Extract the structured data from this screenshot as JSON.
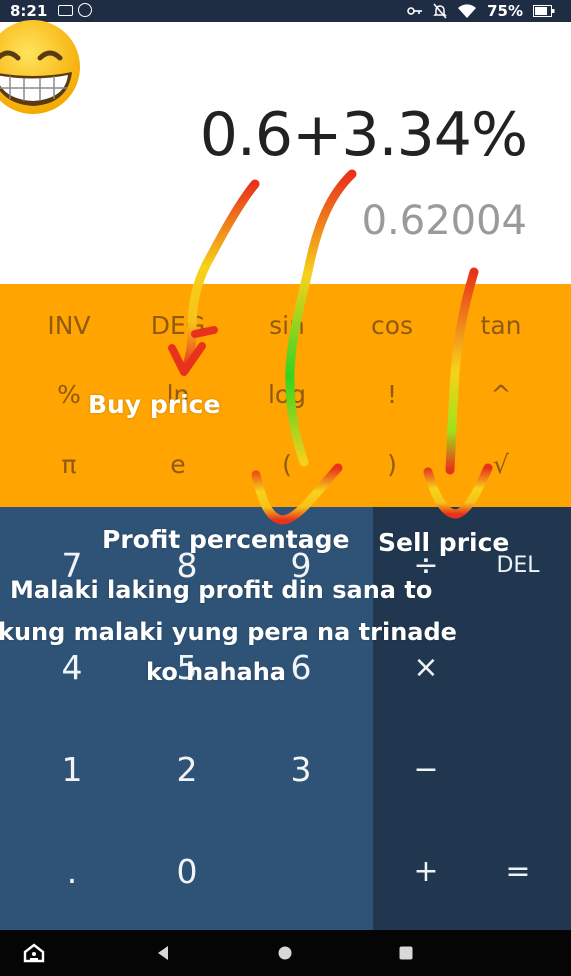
{
  "status_bar": {
    "time": "8:21",
    "battery": "75%",
    "icons": [
      "message-icon",
      "messenger-icon",
      "key-icon",
      "mute-icon",
      "wifi-icon",
      "battery-icon"
    ]
  },
  "display": {
    "expression": "0.6+3.34%",
    "result": "0.62004"
  },
  "scientific": {
    "row1": [
      "INV",
      "DEG",
      "sin",
      "cos",
      "tan"
    ],
    "row2": [
      "%",
      "ln",
      "log",
      "!",
      "^"
    ],
    "row3": [
      "π",
      "e",
      "(",
      ")",
      "√"
    ]
  },
  "keypad": {
    "row1": [
      "7",
      "8",
      "9"
    ],
    "row2": [
      "4",
      "5",
      "6"
    ],
    "row3": [
      "1",
      "2",
      "3"
    ],
    "row4": [
      ".",
      "0"
    ]
  },
  "operators": {
    "divide": "÷",
    "delete": "DEL",
    "multiply": "×",
    "minus": "−",
    "plus": "+",
    "equals": "="
  },
  "annotations": {
    "buy_price": "Buy price",
    "profit_percentage": "Profit percentage",
    "sell_price": "Sell price",
    "caption_line1": "Malaki laking profit din sana to",
    "caption_line2": "kung malaki yung pera na trinade",
    "caption_line3": "ko hahaha"
  },
  "colors": {
    "sci_panel": "#ffa400",
    "num_panel": "#2f5376",
    "op_panel": "#20374f",
    "status_bar": "#1f2d44"
  },
  "nav_icons": [
    "accessibility-icon",
    "back-icon",
    "home-icon",
    "recents-icon"
  ]
}
